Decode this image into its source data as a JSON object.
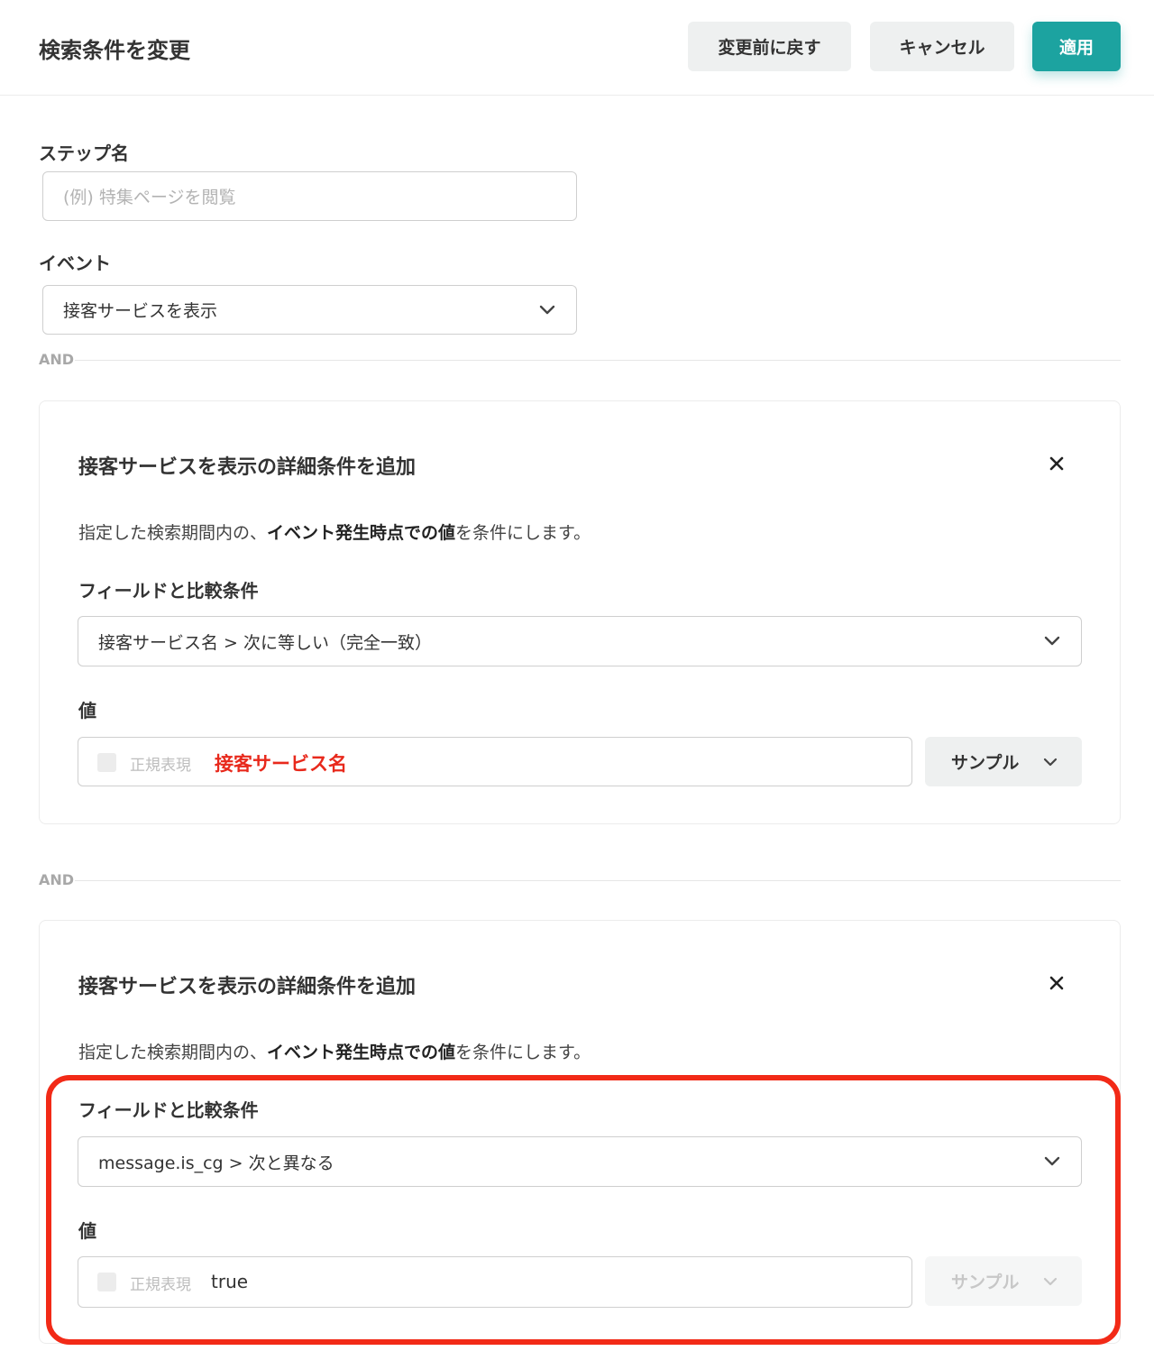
{
  "header": {
    "title": "検索条件を変更",
    "revert_label": "変更前に戻す",
    "cancel_label": "キャンセル",
    "apply_label": "適用"
  },
  "step": {
    "label": "ステップ名",
    "placeholder": "(例) 特集ページを閲覧"
  },
  "event": {
    "label": "イベント",
    "selected": "接客サービスを表示"
  },
  "and_label": "AND",
  "cards": [
    {
      "title": "接客サービスを表示の詳細条件を追加",
      "desc_pre": "指定した検索期間内の、",
      "desc_bold": "イベント発生時点での値",
      "desc_post": "を条件にします。",
      "field_label": "フィールドと比較条件",
      "field_selected": "接客サービス名 > 次に等しい（完全一致）",
      "value_label": "値",
      "regex_label": "正規表現",
      "value": "接客サービス名",
      "sample_label": "サンプル"
    },
    {
      "title": "接客サービスを表示の詳細条件を追加",
      "desc_pre": "指定した検索期間内の、",
      "desc_bold": "イベント発生時点での値",
      "desc_post": "を条件にします。",
      "field_label": "フィールドと比較条件",
      "field_selected": "message.is_cg > 次と異なる",
      "value_label": "値",
      "regex_label": "正規表現",
      "value": "true",
      "sample_label": "サンプル"
    }
  ],
  "colors": {
    "accent": "#1ca3a0",
    "highlight": "#f22a17",
    "value_red": "#e8291c"
  },
  "icons": {
    "dropdown": "chevron-down-icon",
    "close": "close-icon"
  }
}
